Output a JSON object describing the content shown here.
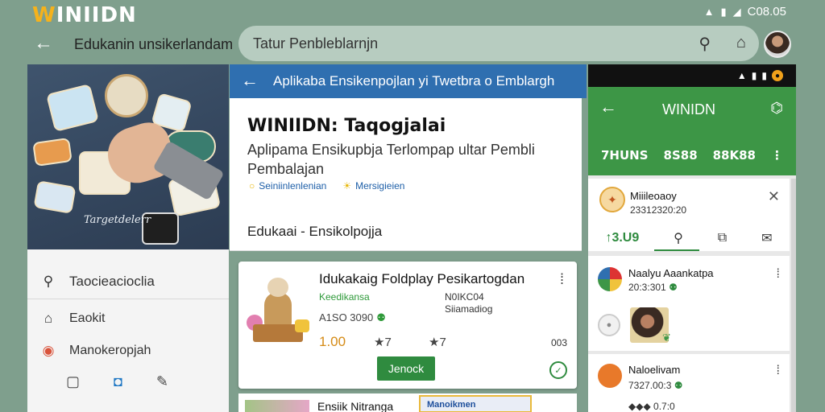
{
  "topbar": {
    "brand_a": "W",
    "brand_b": "INIIDN",
    "status_time": "C08.05",
    "breadcrumb": "Edukanin unsikerlandam",
    "search_placeholder": "Tatur Penbleblarnjn"
  },
  "left_panel": {
    "hero_caption": "Targetdelerr",
    "menu": [
      {
        "icon": "search-icon",
        "label": "Taocieacioclia"
      },
      {
        "icon": "home-icon",
        "label": "Eaokit"
      },
      {
        "icon": "pin-icon",
        "label": "Manokeropjah"
      }
    ]
  },
  "main": {
    "header_title": "Aplikaba Ensikenpojlan yi Twetbra o Emblargh",
    "app_title": "WINIIDN: Taqogjalai",
    "app_desc": "Aplipama Ensikupbja Terlompap ultar Pembli Pembalajan",
    "tags": [
      "Seiniinlenlenian",
      "Mersigieien"
    ],
    "category": "Edukaai - Ensikolpojja"
  },
  "game_card": {
    "title": "Idukakaig Foldplay Pesikartogdan",
    "developer": "Keedikansa",
    "meta1": "A1SO 3090",
    "meta_right_1": "N0IKC04",
    "meta_right_2": "Siiamadiog",
    "price": "1.00",
    "stat1": "★7",
    "stat2": "★7",
    "count": "003",
    "install_label": "Jenock"
  },
  "bottom_card": {
    "title": "Ensiik Nitranga",
    "banner": "Manoikmen"
  },
  "phone": {
    "title": "WINIDN",
    "tabs": [
      "7HUNS",
      "8S88",
      "88K88"
    ],
    "notif1": {
      "title": "Miiileoaoy",
      "sub": "23312320:20",
      "action": "↑3.U9"
    },
    "notif2": {
      "title": "Naalyu Aaankatpa",
      "sub": "20:3:301"
    },
    "notif3": {
      "title": "Naloelivam",
      "sub": "7327.00:3",
      "row": "◆◆◆ 0.7:0"
    }
  },
  "colors": {
    "accent_blue": "#2f6fb0",
    "accent_green": "#3d9646",
    "brand_yellow": "#f5b21c",
    "background": "#7f9f8d"
  }
}
